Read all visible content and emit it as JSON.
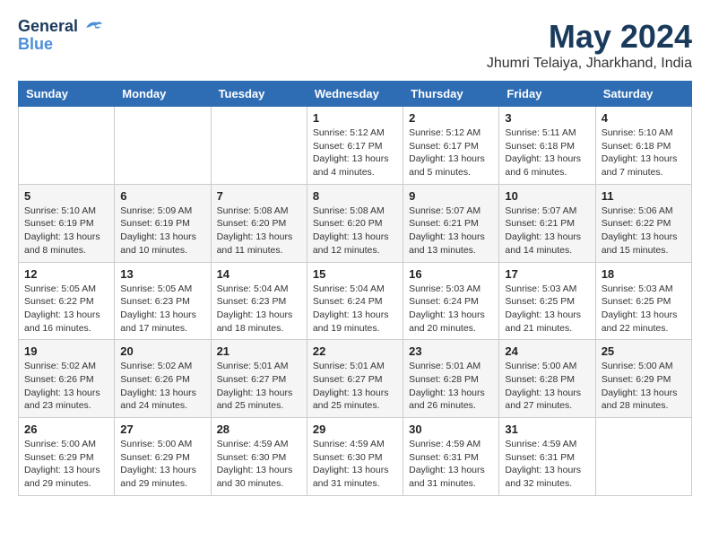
{
  "logo": {
    "line1": "General",
    "line2": "Blue"
  },
  "title": "May 2024",
  "location": "Jhumri Telaiya, Jharkhand, India",
  "days_of_week": [
    "Sunday",
    "Monday",
    "Tuesday",
    "Wednesday",
    "Thursday",
    "Friday",
    "Saturday"
  ],
  "weeks": [
    [
      {
        "day": "",
        "info": ""
      },
      {
        "day": "",
        "info": ""
      },
      {
        "day": "",
        "info": ""
      },
      {
        "day": "1",
        "info": "Sunrise: 5:12 AM\nSunset: 6:17 PM\nDaylight: 13 hours\nand 4 minutes."
      },
      {
        "day": "2",
        "info": "Sunrise: 5:12 AM\nSunset: 6:17 PM\nDaylight: 13 hours\nand 5 minutes."
      },
      {
        "day": "3",
        "info": "Sunrise: 5:11 AM\nSunset: 6:18 PM\nDaylight: 13 hours\nand 6 minutes."
      },
      {
        "day": "4",
        "info": "Sunrise: 5:10 AM\nSunset: 6:18 PM\nDaylight: 13 hours\nand 7 minutes."
      }
    ],
    [
      {
        "day": "5",
        "info": "Sunrise: 5:10 AM\nSunset: 6:19 PM\nDaylight: 13 hours\nand 8 minutes."
      },
      {
        "day": "6",
        "info": "Sunrise: 5:09 AM\nSunset: 6:19 PM\nDaylight: 13 hours\nand 10 minutes."
      },
      {
        "day": "7",
        "info": "Sunrise: 5:08 AM\nSunset: 6:20 PM\nDaylight: 13 hours\nand 11 minutes."
      },
      {
        "day": "8",
        "info": "Sunrise: 5:08 AM\nSunset: 6:20 PM\nDaylight: 13 hours\nand 12 minutes."
      },
      {
        "day": "9",
        "info": "Sunrise: 5:07 AM\nSunset: 6:21 PM\nDaylight: 13 hours\nand 13 minutes."
      },
      {
        "day": "10",
        "info": "Sunrise: 5:07 AM\nSunset: 6:21 PM\nDaylight: 13 hours\nand 14 minutes."
      },
      {
        "day": "11",
        "info": "Sunrise: 5:06 AM\nSunset: 6:22 PM\nDaylight: 13 hours\nand 15 minutes."
      }
    ],
    [
      {
        "day": "12",
        "info": "Sunrise: 5:05 AM\nSunset: 6:22 PM\nDaylight: 13 hours\nand 16 minutes."
      },
      {
        "day": "13",
        "info": "Sunrise: 5:05 AM\nSunset: 6:23 PM\nDaylight: 13 hours\nand 17 minutes."
      },
      {
        "day": "14",
        "info": "Sunrise: 5:04 AM\nSunset: 6:23 PM\nDaylight: 13 hours\nand 18 minutes."
      },
      {
        "day": "15",
        "info": "Sunrise: 5:04 AM\nSunset: 6:24 PM\nDaylight: 13 hours\nand 19 minutes."
      },
      {
        "day": "16",
        "info": "Sunrise: 5:03 AM\nSunset: 6:24 PM\nDaylight: 13 hours\nand 20 minutes."
      },
      {
        "day": "17",
        "info": "Sunrise: 5:03 AM\nSunset: 6:25 PM\nDaylight: 13 hours\nand 21 minutes."
      },
      {
        "day": "18",
        "info": "Sunrise: 5:03 AM\nSunset: 6:25 PM\nDaylight: 13 hours\nand 22 minutes."
      }
    ],
    [
      {
        "day": "19",
        "info": "Sunrise: 5:02 AM\nSunset: 6:26 PM\nDaylight: 13 hours\nand 23 minutes."
      },
      {
        "day": "20",
        "info": "Sunrise: 5:02 AM\nSunset: 6:26 PM\nDaylight: 13 hours\nand 24 minutes."
      },
      {
        "day": "21",
        "info": "Sunrise: 5:01 AM\nSunset: 6:27 PM\nDaylight: 13 hours\nand 25 minutes."
      },
      {
        "day": "22",
        "info": "Sunrise: 5:01 AM\nSunset: 6:27 PM\nDaylight: 13 hours\nand 25 minutes."
      },
      {
        "day": "23",
        "info": "Sunrise: 5:01 AM\nSunset: 6:28 PM\nDaylight: 13 hours\nand 26 minutes."
      },
      {
        "day": "24",
        "info": "Sunrise: 5:00 AM\nSunset: 6:28 PM\nDaylight: 13 hours\nand 27 minutes."
      },
      {
        "day": "25",
        "info": "Sunrise: 5:00 AM\nSunset: 6:29 PM\nDaylight: 13 hours\nand 28 minutes."
      }
    ],
    [
      {
        "day": "26",
        "info": "Sunrise: 5:00 AM\nSunset: 6:29 PM\nDaylight: 13 hours\nand 29 minutes."
      },
      {
        "day": "27",
        "info": "Sunrise: 5:00 AM\nSunset: 6:29 PM\nDaylight: 13 hours\nand 29 minutes."
      },
      {
        "day": "28",
        "info": "Sunrise: 4:59 AM\nSunset: 6:30 PM\nDaylight: 13 hours\nand 30 minutes."
      },
      {
        "day": "29",
        "info": "Sunrise: 4:59 AM\nSunset: 6:30 PM\nDaylight: 13 hours\nand 31 minutes."
      },
      {
        "day": "30",
        "info": "Sunrise: 4:59 AM\nSunset: 6:31 PM\nDaylight: 13 hours\nand 31 minutes."
      },
      {
        "day": "31",
        "info": "Sunrise: 4:59 AM\nSunset: 6:31 PM\nDaylight: 13 hours\nand 32 minutes."
      },
      {
        "day": "",
        "info": ""
      }
    ]
  ]
}
